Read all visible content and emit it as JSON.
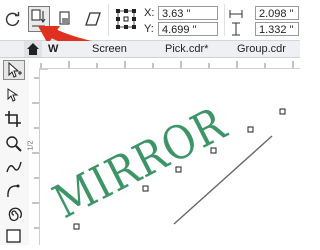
{
  "toolbar": {
    "x_label": "X:",
    "x_value": "3.63 \"",
    "y_label": "Y:",
    "y_value": "4.699 \"",
    "w_value": "2.098 \"",
    "h_value": "1.332 \"",
    "arrow_color": "#e0301e"
  },
  "tabs": [
    {
      "label": "W"
    },
    {
      "label": "Screen"
    },
    {
      "label": "Pick.cdr*"
    },
    {
      "label": "Group.cdr"
    }
  ],
  "ruler": {
    "v_label": "1/2"
  },
  "canvas": {
    "text": "MIRROR",
    "text_color": "#3d9466"
  }
}
